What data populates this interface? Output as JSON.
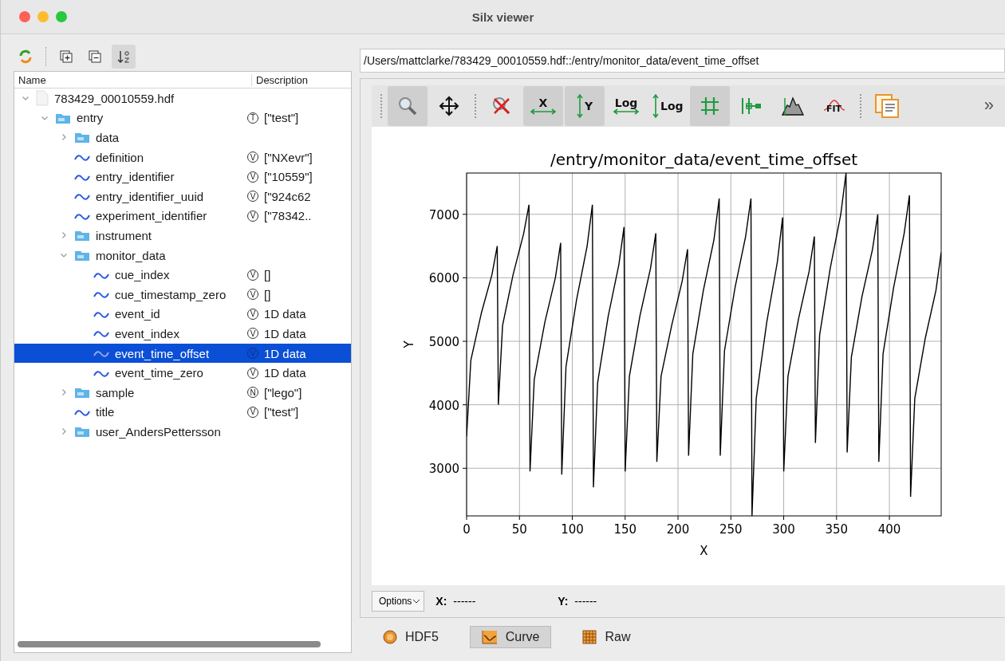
{
  "window": {
    "title": "Silx viewer"
  },
  "tree_toolbar": [
    {
      "kind": "reload",
      "pressed": false
    },
    {
      "kind": "expand",
      "pressed": false
    },
    {
      "kind": "collapse",
      "pressed": false
    },
    {
      "kind": "sort",
      "pressed": true
    }
  ],
  "tree": {
    "columns": [
      "Name",
      "Description"
    ],
    "items": [
      {
        "name": "783429_00010559.hdf",
        "kind": "file",
        "expanded": true,
        "selected": false,
        "children": [
          {
            "name": "entry",
            "kind": "group",
            "expanded": true,
            "selected": false,
            "badge": "T",
            "description": "[\"test\"]",
            "children": [
              {
                "name": "data",
                "kind": "group",
                "expanded": false,
                "selected": false
              },
              {
                "name": "definition",
                "kind": "dataset",
                "selected": false,
                "badge": "V",
                "description": "[\"NXevr\"]"
              },
              {
                "name": "entry_identifier",
                "kind": "dataset",
                "selected": false,
                "badge": "V",
                "description": "[\"10559\"]"
              },
              {
                "name": "entry_identifier_uuid",
                "kind": "dataset",
                "selected": false,
                "badge": "V",
                "description": "[\"924c62"
              },
              {
                "name": "experiment_identifier",
                "kind": "dataset",
                "selected": false,
                "badge": "V",
                "description": "[\"78342.."
              },
              {
                "name": "instrument",
                "kind": "group",
                "expanded": false,
                "selected": false
              },
              {
                "name": "monitor_data",
                "kind": "group",
                "expanded": true,
                "selected": false,
                "children": [
                  {
                    "name": "cue_index",
                    "kind": "dataset",
                    "selected": false,
                    "badge": "V",
                    "description": "[]"
                  },
                  {
                    "name": "cue_timestamp_zero",
                    "kind": "dataset",
                    "selected": false,
                    "badge": "V",
                    "description": "[]"
                  },
                  {
                    "name": "event_id",
                    "kind": "dataset",
                    "selected": false,
                    "badge": "V",
                    "description": "1D data"
                  },
                  {
                    "name": "event_index",
                    "kind": "dataset",
                    "selected": false,
                    "badge": "V",
                    "description": "1D data"
                  },
                  {
                    "name": "event_time_offset",
                    "kind": "dataset",
                    "selected": true,
                    "badge": "V",
                    "description": "1D data"
                  },
                  {
                    "name": "event_time_zero",
                    "kind": "dataset",
                    "selected": false,
                    "badge": "V",
                    "description": "1D data"
                  }
                ]
              },
              {
                "name": "sample",
                "kind": "group",
                "expanded": false,
                "selected": false,
                "badge": "N",
                "description": "[\"lego\"]"
              },
              {
                "name": "title",
                "kind": "dataset",
                "selected": false,
                "badge": "V",
                "description": "[\"test\"]"
              },
              {
                "name": "user_AndersPettersson",
                "kind": "group",
                "expanded": false,
                "selected": false
              }
            ]
          }
        ]
      }
    ]
  },
  "path": "/Users/mattclarke/783429_00010559.hdf::/entry/monitor_data/event_time_offset",
  "plot_toolbar": {
    "items": [
      {
        "kind": "separator"
      },
      {
        "kind": "zoom",
        "pressed": true
      },
      {
        "kind": "pan",
        "pressed": false
      },
      {
        "kind": "separator"
      },
      {
        "kind": "reset-zoom",
        "pressed": false
      },
      {
        "kind": "autoscale-x",
        "pressed": true,
        "label": "X"
      },
      {
        "kind": "autoscale-y",
        "pressed": true,
        "label": "Y"
      },
      {
        "kind": "log-x",
        "pressed": false,
        "label": "Log"
      },
      {
        "kind": "log-y",
        "pressed": false,
        "label": "Log"
      },
      {
        "kind": "grid",
        "pressed": true
      },
      {
        "kind": "curve-style",
        "pressed": false
      },
      {
        "kind": "histogram",
        "pressed": false
      },
      {
        "kind": "fit",
        "pressed": false,
        "label": "FIT"
      },
      {
        "kind": "separator"
      },
      {
        "kind": "copy",
        "pressed": false
      }
    ],
    "overflow": "»"
  },
  "chart_data": {
    "type": "line",
    "title": "/entry/monitor_data/event_time_offset",
    "xlabel": "X",
    "ylabel": "Y",
    "x": [
      0,
      4,
      14,
      24,
      29,
      30,
      34,
      44,
      54,
      59,
      60,
      64,
      74,
      84,
      89,
      90,
      94,
      104,
      114,
      119,
      120,
      124,
      134,
      144,
      149,
      150,
      154,
      164,
      174,
      179,
      180,
      184,
      194,
      204,
      209,
      210,
      214,
      224,
      234,
      239,
      240,
      244,
      254,
      264,
      269,
      270,
      274,
      284,
      294,
      299,
      300,
      304,
      314,
      324,
      329,
      330,
      334,
      344,
      354,
      359,
      360,
      364,
      374,
      384,
      389,
      390,
      394,
      404,
      414,
      419,
      420,
      424,
      434,
      444,
      449
    ],
    "series": [
      {
        "color": "#000000",
        "values": [
          3500,
          4700,
          5450,
          6050,
          6500,
          4000,
          5250,
          6050,
          6700,
          7150,
          2950,
          4400,
          5300,
          6000,
          6550,
          2900,
          4600,
          5650,
          6500,
          7150,
          2700,
          4350,
          5400,
          6200,
          6800,
          2950,
          4450,
          5400,
          6150,
          6700,
          3100,
          4450,
          5250,
          5950,
          6450,
          3200,
          4800,
          5800,
          6600,
          7250,
          3200,
          4850,
          5850,
          6650,
          7250,
          2250,
          4100,
          5300,
          6250,
          6950,
          2950,
          4450,
          5350,
          6100,
          6650,
          3400,
          5100,
          6150,
          7000,
          7650,
          3250,
          4750,
          5700,
          6450,
          7000,
          3100,
          4800,
          5850,
          6700,
          7300,
          2550,
          4100,
          5050,
          5800,
          6400
        ]
      }
    ],
    "grid": true,
    "xlim": [
      0,
      449
    ],
    "ylim": [
      2250,
      7650
    ],
    "xticks": [
      0,
      50,
      100,
      150,
      200,
      250,
      300,
      350,
      400
    ],
    "yticks": [
      3000,
      4000,
      5000,
      6000,
      7000
    ]
  },
  "status": {
    "options": "Options",
    "x_label": "X:",
    "x_value": "------",
    "y_label": "Y:",
    "y_value": "------"
  },
  "views": [
    {
      "kind": "hdf5",
      "label": "HDF5",
      "selected": false
    },
    {
      "kind": "curve",
      "label": "Curve",
      "selected": true
    },
    {
      "kind": "raw",
      "label": "Raw",
      "selected": false
    }
  ]
}
